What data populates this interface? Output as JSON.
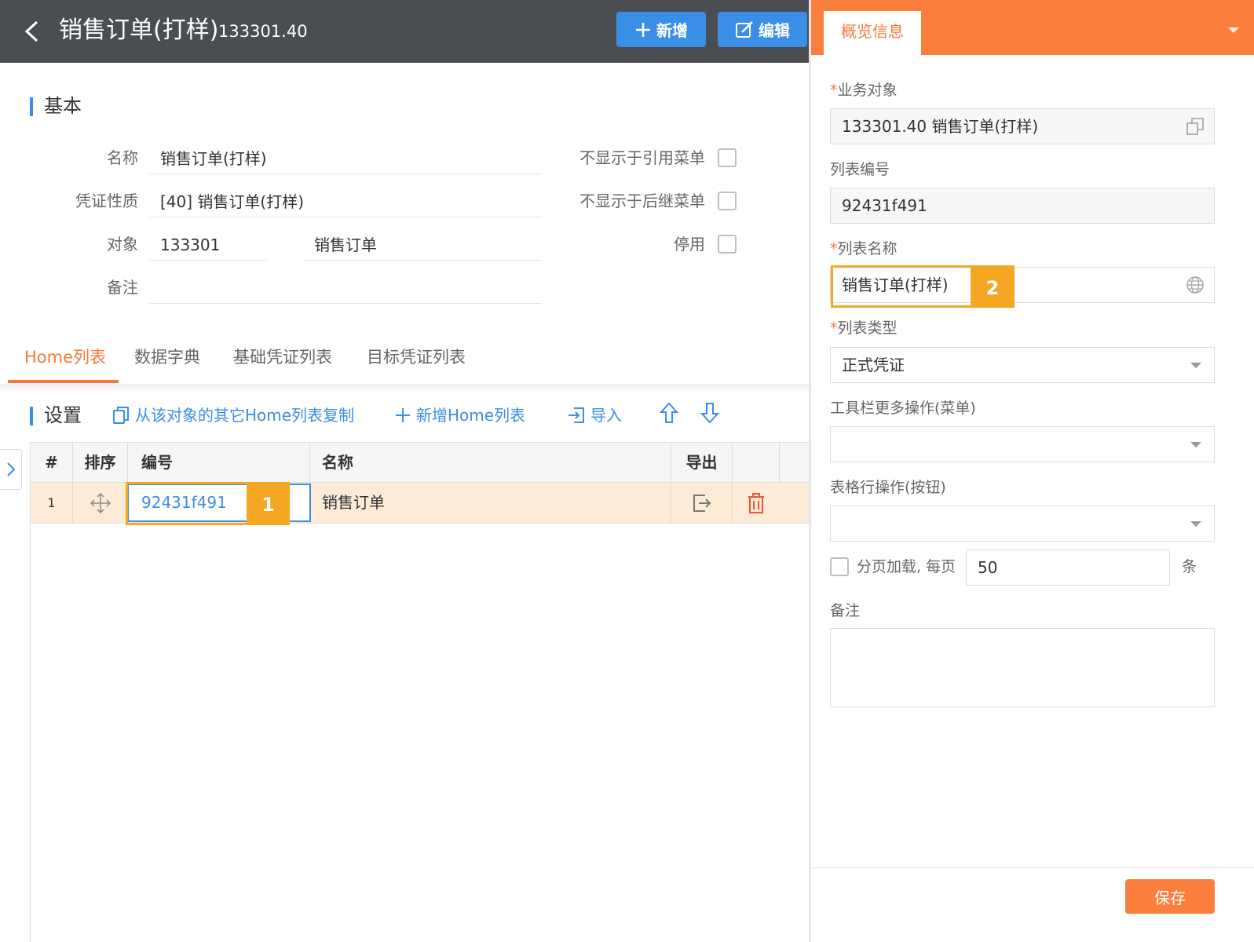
{
  "topbar": {
    "title": "销售订单(打样)",
    "code": "133301.40",
    "add_label": "新增",
    "edit_label": "编辑"
  },
  "basic": {
    "section_title": "基本",
    "name_label": "名称",
    "name_value": "销售订单(打样)",
    "voucher_label": "凭证性质",
    "voucher_value": "[40] 销售订单(打样)",
    "object_label": "对象",
    "object_code": "133301",
    "object_name": "销售订单",
    "remark_label": "备注",
    "remark_value": "",
    "hide_ref_label": "不显示于引用菜单",
    "hide_next_label": "不显示于后继菜单",
    "disable_label": "停用"
  },
  "tabs": [
    {
      "label": "Home列表"
    },
    {
      "label": "数据字典"
    },
    {
      "label": "基础凭证列表"
    },
    {
      "label": "目标凭证列表"
    }
  ],
  "settings": {
    "section_title": "设置",
    "copy_label": "从该对象的其它Home列表复制",
    "add_home_label": "新增Home列表",
    "import_label": "导入"
  },
  "grid": {
    "headers": {
      "index": "#",
      "sort": "排序",
      "code": "编号",
      "name": "名称",
      "export": "导出"
    },
    "rows": [
      {
        "index": "1",
        "code": "92431f491",
        "name": "销售订单"
      }
    ]
  },
  "badges": {
    "one": "1",
    "two": "2"
  },
  "panel": {
    "tab_label": "概览信息",
    "biz_object_label": "业务对象",
    "biz_object_value": "133301.40 销售订单(打样)",
    "list_code_label": "列表编号",
    "list_code_value": "92431f491",
    "list_name_label": "列表名称",
    "list_name_value": "销售订单(打样)",
    "list_type_label": "列表类型",
    "list_type_value": "正式凭证",
    "toolbar_more_label": "工具栏更多操作(菜单)",
    "toolbar_more_value": "",
    "row_ops_label": "表格行操作(按钮)",
    "row_ops_value": "",
    "paging_label": "分页加载, 每页",
    "paging_value": "50",
    "paging_unit": "条",
    "remark_label": "备注",
    "required_mark": "*",
    "save_label": "保存"
  },
  "colors": {
    "accent_orange": "#fb7f3c",
    "accent_blue": "#3a8ee6",
    "highlight": "#f5a623",
    "topbar": "#4a4d52"
  }
}
